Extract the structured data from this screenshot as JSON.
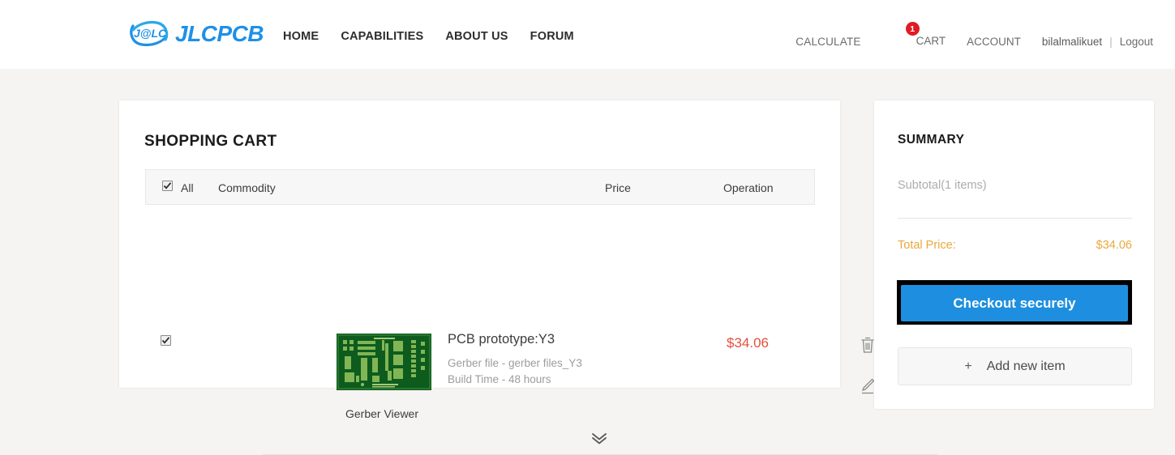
{
  "brand": {
    "logo_icon": "jlc-swoosh-logo-icon",
    "logo_mark_text": "J@LC",
    "name": "JLCPCB",
    "accent_blue": "#1e90e8"
  },
  "nav": {
    "items": [
      {
        "label": "HOME"
      },
      {
        "label": "CAPABILITIES"
      },
      {
        "label": "ABOUT US"
      },
      {
        "label": "FORUM"
      }
    ]
  },
  "utility": {
    "calculate": "CALCULATE",
    "cart": "CART",
    "cart_badge": "1",
    "cart_badge_color": "#e01b24",
    "account": "ACCOUNT",
    "username": "bilalmalikuet",
    "separator": "|",
    "logout": "Logout"
  },
  "cart": {
    "title": "SHOPPING CART",
    "select_all_label": "All",
    "select_all_checked": true,
    "columns": {
      "commodity": "Commodity",
      "price": "Price",
      "operation": "Operation"
    },
    "items": [
      {
        "checked": true,
        "thumbnail_icon": "pcb-board-thumbnail",
        "gerber_viewer_link": "Gerber Viewer",
        "title": "PCB prototype:Y3",
        "detail_gerber": "Gerber file - gerber files_Y3",
        "detail_build_time": "Build Time - 48 hours",
        "price": "$34.06",
        "price_color": "#e2503c",
        "delete_icon": "trash-icon",
        "edit_icon": "pencil-icon"
      }
    ],
    "expand_icon": "double-chevron-down-icon"
  },
  "summary": {
    "title": "SUMMARY",
    "subtotal_label": "Subtotal(1 items)",
    "total_label": "Total Price:",
    "total_value": "$34.06",
    "total_color": "#eaa83c",
    "checkout_label": "Checkout securely",
    "checkout_color": "#1e8fe0",
    "add_item_plus": "+",
    "add_item_label": "Add new item"
  }
}
